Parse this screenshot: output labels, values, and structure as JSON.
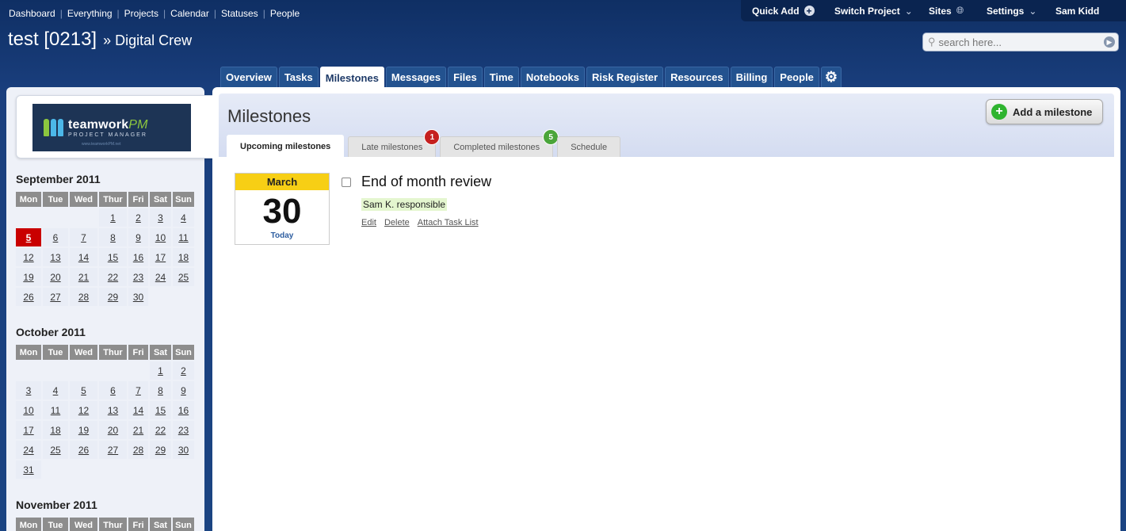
{
  "topnav": [
    "Dashboard",
    "Everything",
    "Projects",
    "Calendar",
    "Statuses",
    "People"
  ],
  "userbar": {
    "quick_add": "Quick Add",
    "switch_project": "Switch Project",
    "sites": "Sites",
    "settings": "Settings",
    "user": "Sam Kidd"
  },
  "header": {
    "project_name": "test [0213]",
    "crumb_sep": "»",
    "company": "Digital Crew",
    "search_placeholder": "search here..."
  },
  "tabs": [
    "Overview",
    "Tasks",
    "Milestones",
    "Messages",
    "Files",
    "Time",
    "Notebooks",
    "Risk Register",
    "Resources",
    "Billing",
    "People"
  ],
  "active_tab": "Milestones",
  "logo": {
    "brand": "teamwork",
    "brand_suffix": "PM",
    "sub": "PROJECT MANAGER",
    "url": "www.teamworkPM.net"
  },
  "calendar": {
    "days": [
      "Mon",
      "Tue",
      "Wed",
      "Thur",
      "Fri",
      "Sat",
      "Sun"
    ],
    "months": [
      {
        "title": "September 2011",
        "weeks": [
          [
            "",
            "",
            "",
            "1",
            "2",
            "3",
            "4"
          ],
          [
            "5",
            "6",
            "7",
            "8",
            "9",
            "10",
            "11"
          ],
          [
            "12",
            "13",
            "14",
            "15",
            "16",
            "17",
            "18"
          ],
          [
            "19",
            "20",
            "21",
            "22",
            "23",
            "24",
            "25"
          ],
          [
            "26",
            "27",
            "28",
            "29",
            "30",
            "",
            ""
          ]
        ],
        "today": "5"
      },
      {
        "title": "October 2011",
        "weeks": [
          [
            "",
            "",
            "",
            "",
            "",
            "1",
            "2"
          ],
          [
            "3",
            "4",
            "5",
            "6",
            "7",
            "8",
            "9"
          ],
          [
            "10",
            "11",
            "12",
            "13",
            "14",
            "15",
            "16"
          ],
          [
            "17",
            "18",
            "19",
            "20",
            "21",
            "22",
            "23"
          ],
          [
            "24",
            "25",
            "26",
            "27",
            "28",
            "29",
            "30"
          ],
          [
            "31",
            "",
            "",
            "",
            "",
            "",
            ""
          ]
        ]
      },
      {
        "title": "November 2011",
        "weeks": []
      }
    ]
  },
  "main": {
    "title": "Milestones",
    "add_button": "Add a milestone",
    "subtabs": [
      {
        "label": "Upcoming milestones",
        "active": true
      },
      {
        "label": "Late milestones",
        "badge": "1"
      },
      {
        "label": "Completed milestones",
        "badge": "5"
      },
      {
        "label": "Schedule"
      }
    ]
  },
  "milestone": {
    "month": "March",
    "day": "30",
    "relative": "Today",
    "title": "End of month review",
    "responsible": "Sam K. responsible",
    "actions": [
      "Edit",
      "Delete",
      "Attach Task List"
    ]
  },
  "colors": {
    "header_bg": "#1a3f7e",
    "tab_bg": "#23528f",
    "today_bg": "#c90000",
    "date_month_bg": "#f7cf15",
    "badge_late": "#c52020",
    "badge_completed": "#4aa53a",
    "add_icon": "#2fb42f"
  }
}
